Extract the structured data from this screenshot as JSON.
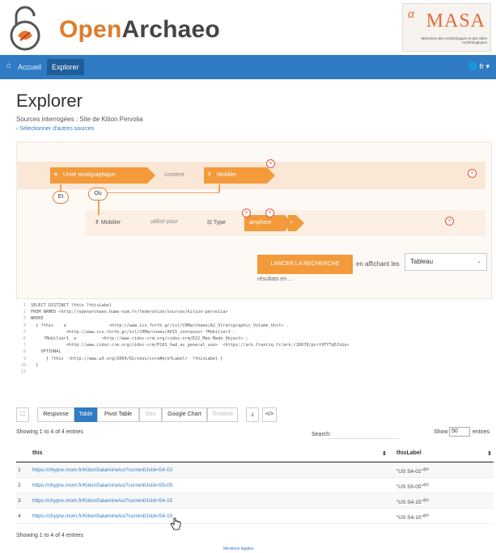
{
  "header": {
    "brand_prefix": "Open",
    "brand_suffix": "Archaeo",
    "partner_logo": {
      "word": "MASA",
      "alpha": "α",
      "subtitle": "Mémoires des Archéologues et des Sites Archéologiques"
    }
  },
  "navbar": {
    "home_icon": "home-icon",
    "accueil": "Accueil",
    "explorer": "Explorer",
    "lang": "🌐 fr ▾"
  },
  "page": {
    "title": "Explorer",
    "sources": "Sources interrogées : Site de Kition Pervolia",
    "select_sources": "‹ Sélectionner d'autres sources"
  },
  "query_builder": {
    "row1": {
      "subject": "Unité stratigraphique",
      "property": "contient",
      "object": "Mobilier"
    },
    "and_label": "Et",
    "or_label": "Où",
    "row2": {
      "subject": "Mobilier",
      "property": "utilisé pour",
      "type_label": "Type",
      "value": "amphore"
    },
    "launch_button": "LANCER LA RECHERCHE",
    "display_label": "en affichant les",
    "display_value": "Tableau",
    "results_text": "résultats en ..."
  },
  "code_lines": [
    [
      "1",
      "SELECT DISTINCT ?this ?thisLabel"
    ],
    [
      "2",
      "FROM NAMED <http://openarchaeo.huma-num.fr/federation/sources/kition-pervolia>"
    ],
    [
      "3",
      "WHERE"
    ],
    [
      "4",
      "  { ?this    a                 <http://www.ics.forth.gr/isl/CRMarchaeo/A2_Stratigraphic_Volume_Unit> ."
    ],
    [
      "5",
      "              <http://www.ics.forth.gr/isl/CRMarchaeo/AP15_contains> ?Mobilier1 ."
    ],
    [
      "6",
      "     ?Mobilier1  a          <http://www.cidoc-crm.org/cidoc-crm/E22_Man-Made_Object> ;"
    ],
    [
      "7",
      "              <http://www.cidoc-crm.org/cidoc-crm/P101_had_as_general_use>  <https://ark.frantiq.fr/ark:/26678/pcrtVFfTq5JiGu>"
    ],
    [
      "8",
      "    OPTIONAL"
    ],
    [
      "9",
      "      { ?this  <http://www.w3.org/2004/02/skos/core#prefLabel>  ?thisLabel }"
    ],
    [
      "10",
      "  }"
    ],
    [
      "11",
      ""
    ]
  ],
  "toolbar": {
    "buttons": [
      "Response",
      "Table",
      "Pivot Table",
      "Geo",
      "Google Chart",
      "Timeline"
    ],
    "active": "Table"
  },
  "table": {
    "showing_top": "Showing 1 to 4 of 4 entries",
    "search_label": "Search:",
    "show_label": "Show",
    "show_value": "50",
    "entries_label": "entries",
    "columns": [
      "this",
      "thisLabel"
    ],
    "rows": [
      {
        "idx": "1",
        "uri": "https://chypre.mom.fr/KitionSalamine/us?currentUsId=S4-02",
        "label": "\"US S4-02\"",
        "lang": "@fr"
      },
      {
        "idx": "2",
        "uri": "https://chypre.mom.fr/KitionSalamine/us?currentUsId=S5-05",
        "label": "\"US S5-05\"",
        "lang": "@fr"
      },
      {
        "idx": "3",
        "uri": "https://chypre.mom.fr/KitionSalamine/us?currentUsId=S4-15",
        "label": "\"US S4-15\"",
        "lang": "@fr"
      },
      {
        "idx": "4",
        "uri": "https://chypre.mom.fr/KitionSalamine/us?currentUsId=S4-10",
        "label": "\"US S4-10\"",
        "lang": "@fr"
      }
    ],
    "showing_bottom": "Showing 1 to 4 of 4 entries"
  },
  "footer": {
    "legal": "Mentions légales"
  },
  "colors": {
    "accent_orange": "#f39a3b",
    "brand_orange": "#e07b2a",
    "nav_blue": "#2f7bc4"
  }
}
